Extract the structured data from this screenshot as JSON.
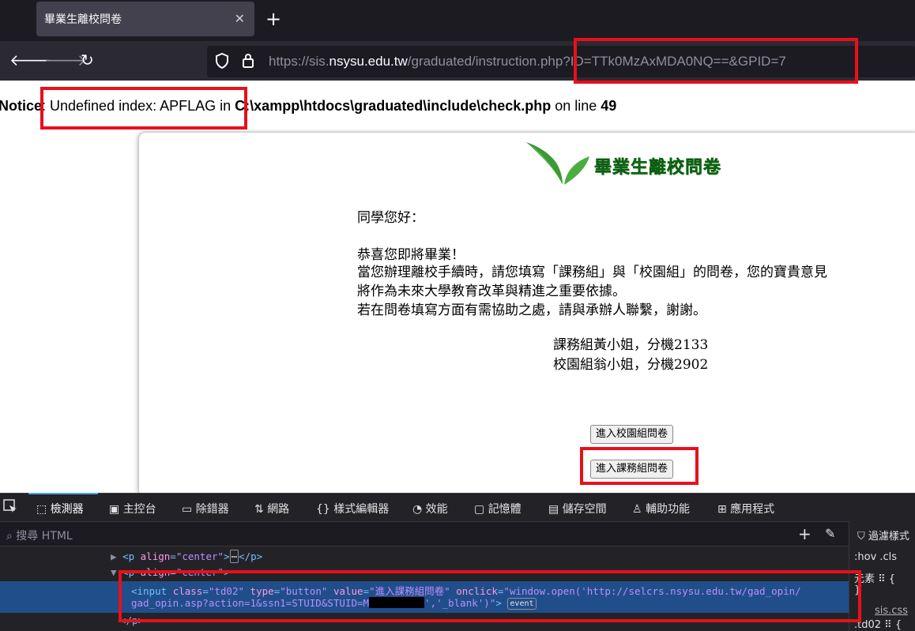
{
  "browser": {
    "tab_title": "畢業生離校問卷",
    "tab_close": "✕",
    "new_tab": "+",
    "url_prefix": "https://sis.",
    "url_host": "nsysu.edu.tw",
    "url_rest": "/graduated/instruction.php?ID=TTk0MzAxMDA0NQ==&GPID=7"
  },
  "notice": {
    "label": "Notice",
    "text_a": ": Undefined index: APFLAG in ",
    "path": "C:\\xampp\\htdocs\\graduated\\include\\check.php",
    "text_b": " on line ",
    "line": "49"
  },
  "page": {
    "logo_title": "畢業生離校問卷",
    "greeting": "同學您好：",
    "congrats": "恭喜您即將畢業！",
    "para1": "當您辦理離校手續時，請您填寫「課務組」與「校園組」的問卷，您的寶貴意見",
    "para2": "將作為未來大學教育改革與精進之重要依據。",
    "para3": "若在問卷填寫方面有需協助之處，請與承辦人聯繫，謝謝。",
    "contact1": "課務組黃小姐，分機2133",
    "contact2": "校園組翁小姐，分機2902",
    "btn_campus": "進入校園組問卷",
    "btn_course": "進入課務組問卷"
  },
  "devtools": {
    "tabs": [
      "檢測器",
      "主控台",
      "除錯器",
      "網路",
      "樣式編輯器",
      "效能",
      "記憶體",
      "儲存空間",
      "輔助功能",
      "應用程式"
    ],
    "search_placeholder": "搜尋 HTML",
    "filter_label": "過濾樣式",
    "hov_cls": ":hov .cls",
    "element_label": "元素",
    "stylesheet": "sis.css",
    "selector": ".td02",
    "line1_tag_open": "<p ",
    "line1_attr": "align",
    "line1_val": "\"center\"",
    "line1_ellipsis": "⋯",
    "line1_close": "</p>",
    "input_line1_a": "<input ",
    "input_class_attr": "class",
    "input_class_val": "\"td02\"",
    "input_type_attr": "type",
    "input_type_val": "\"button\"",
    "input_value_attr": "value",
    "input_value_val": "\"進入課務組問卷\"",
    "input_onclick_attr": "onclick",
    "input_onclick_val1": "\"window.open('http://selcrs.nsysu.edu.tw/gad_opin/",
    "input_onclick_val2": "gad_opin.asp?action=1&ssn1=STUID&STUID=M",
    "input_onclick_val3": "','_blank')\"",
    "input_end": ">",
    "event_badge": "event",
    "p_close": "</p>"
  }
}
